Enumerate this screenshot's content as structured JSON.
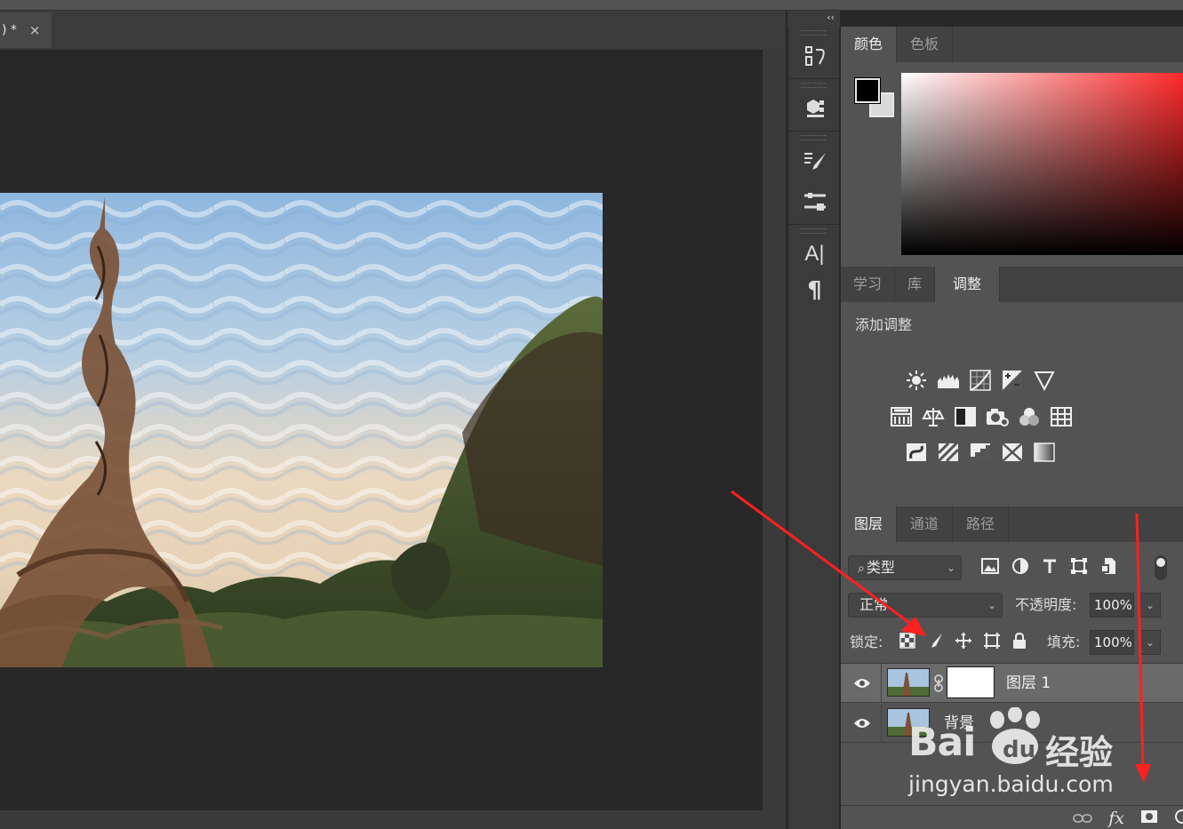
{
  "document": {
    "tab_title": ") *",
    "close_glyph": "×"
  },
  "toolstrip": {
    "collapse_glyph": "‹‹",
    "tools": [
      "history-icon",
      "3d-icon",
      "brush-presets-icon",
      "tool-presets-icon",
      "character-icon",
      "paragraph-icon"
    ],
    "character_glyph": "A|",
    "paragraph_glyph": "¶"
  },
  "color_panel": {
    "tabs": [
      "颜色",
      "色板"
    ],
    "active_tab": "颜色",
    "foreground": "#000000",
    "background": "#d9d9d9",
    "field_hue": "#ff2a2a"
  },
  "adjustments_panel": {
    "tabs": [
      "学习",
      "库",
      "调整"
    ],
    "active_tab": "调整",
    "add_label": "添加调整",
    "icon_rows": [
      [
        "brightness-contrast-icon",
        "levels-icon",
        "curves-icon",
        "exposure-icon",
        "vibrance-icon"
      ],
      [
        "hue-saturation-icon",
        "color-balance-icon",
        "black-white-icon",
        "photo-filter-icon",
        "channel-mixer-icon",
        "color-lookup-icon"
      ],
      [
        "invert-icon",
        "posterize-icon",
        "threshold-icon",
        "selective-color-icon",
        "gradient-map-icon"
      ]
    ]
  },
  "layers_panel": {
    "tabs": [
      "图层",
      "通道",
      "路径"
    ],
    "active_tab": "图层",
    "filter": {
      "search_glyph": "⌕",
      "value": "类型",
      "chevron": "⌄"
    },
    "blend_mode": "正常",
    "opacity_label": "不透明度:",
    "opacity_value": "100%",
    "lock_label": "锁定:",
    "fill_label": "填充:",
    "fill_value": "100%",
    "dropdown_glyph": "⌄",
    "layers": [
      {
        "name": "图层 1",
        "selected": true,
        "has_mask": true
      },
      {
        "name": "背景",
        "selected": false,
        "has_mask": false
      }
    ],
    "footer_fx": "fx"
  },
  "watermark": {
    "brand_latin": "Bai",
    "brand_paw": "du",
    "brand_cn": "经验",
    "url": "jingyan.baidu.com"
  },
  "colors": {
    "annotation_red": "#ff2020",
    "panel_bg": "#535353",
    "panel_tab_bg": "#424242",
    "canvas_bg": "#282828"
  }
}
